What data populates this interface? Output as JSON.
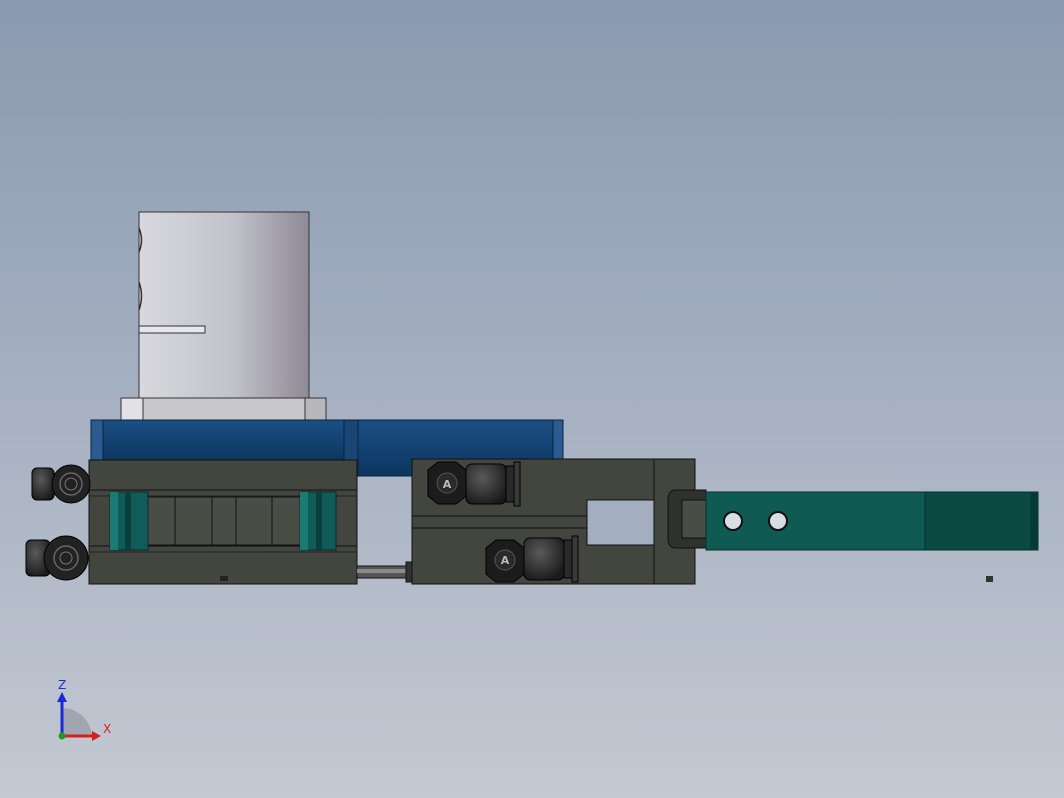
{
  "viewport": {
    "background_top": "#8a9ab0",
    "background_bottom": "#c4c9d2"
  },
  "model_colors": {
    "cylinder": "#c7c7cf",
    "base_plate": "#0f3d6b",
    "body": "#43453f",
    "slide_blocks": "#0f5c58",
    "gripper_arm": "#0f5a52"
  },
  "fittings": {
    "marking": "A"
  },
  "triad": {
    "z_label": "Z",
    "x_label": "X",
    "z_color": "#1a2ad6",
    "x_color": "#d62020",
    "y_color": "#18a018"
  }
}
